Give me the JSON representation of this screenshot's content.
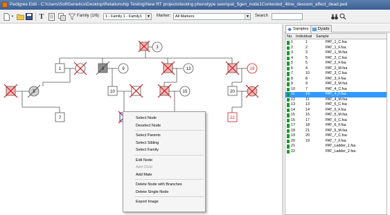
{
  "window": {
    "title": "Pedigree Edit - C:\\Users\\SoftGenetics\\Desktop\\Relationship Testing\\New RT projects\\testing phenotype seen\\pat_5gen_node1Contested_4line_descent_affect_dead.ped"
  },
  "toolbar": {
    "family_label": "Family (1/6):",
    "family_value": "1 - Family 1 - Family1",
    "marker_label": "Marker:",
    "marker_value": "All Markers",
    "search_label": "Search"
  },
  "colors": {
    "titlebar": "#3f6498",
    "selection": "#3399ff",
    "deceased_cross": "#cc1a1a",
    "node_stroke": "#555555",
    "sample_icon": "#1a9a2a",
    "highlight_node_fill": "#f6b8b8"
  },
  "pedigree": {
    "labels": {
      "n3": "3",
      "n1": "1",
      "n8": "8",
      "n9": "9",
      "n13": "13",
      "n19": "19",
      "n5": "5",
      "n10": "10",
      "n15": "15",
      "n20": "20",
      "n7": "7",
      "n22": "22",
      "n21": "21"
    }
  },
  "panel": {
    "tabs": [
      {
        "label": "Samples",
        "icon": "samples-icon"
      },
      {
        "label": "Dyads",
        "icon": "dyads-icon"
      }
    ],
    "columns": [
      "No.",
      "Individual",
      "Sample"
    ],
    "rows": [
      {
        "no": "1",
        "ind": "1",
        "sample": "PAT_1_C.fsa"
      },
      {
        "no": "2",
        "ind": "2",
        "sample": "PAT_1_F.fsa"
      },
      {
        "no": "3",
        "ind": "3",
        "sample": "PAT_1_M.fsa"
      },
      {
        "no": "4",
        "ind": "5",
        "sample": "PAT_2_C.fsa"
      },
      {
        "no": "5",
        "ind": "5",
        "sample": "PAT_2_F.fsa"
      },
      {
        "no": "6",
        "ind": "4",
        "sample": "PAT_2_M.fsa"
      },
      {
        "no": "7",
        "ind": "10",
        "sample": "PAT_3_C.fsa"
      },
      {
        "no": "8",
        "ind": "8",
        "sample": "PAT_3_F.fsa"
      },
      {
        "no": "9",
        "ind": "9",
        "sample": "PAT_3_M.fsa"
      },
      {
        "no": "10",
        "ind": "7",
        "sample": "PAT_4_C.fsa"
      },
      {
        "no": "11",
        "ind": "10",
        "sample": "PAT_4_F.fsa"
      },
      {
        "no": "12",
        "ind": "11",
        "sample": "PAT_4_M.fsa"
      },
      {
        "no": "13",
        "ind": "13",
        "sample": "PAT_5_C.fsa"
      },
      {
        "no": "14",
        "ind": "14",
        "sample": "PAT_5_F.fsa"
      },
      {
        "no": "15",
        "ind": "15",
        "sample": "PAT_5_M.fsa"
      },
      {
        "no": "16",
        "ind": "17",
        "sample": "PAT_6_C.fsa"
      },
      {
        "no": "17",
        "ind": "18",
        "sample": "PAT_6_F.fsa"
      },
      {
        "no": "18",
        "ind": "21",
        "sample": "PAT_6_M.fsa"
      },
      {
        "no": "19",
        "ind": "20",
        "sample": "PAT_7_C.fsa"
      },
      {
        "no": "20",
        "ind": "19",
        "sample": "PAT_7_F.fsa"
      },
      {
        "no": "21",
        "ind": "",
        "sample": "PAT_Ladder_1.fsa"
      },
      {
        "no": "22",
        "ind": "",
        "sample": "PAT_Ladder_2.fsa"
      }
    ],
    "selected_index": 10
  },
  "context_menu": {
    "items": [
      {
        "label": "Select Node",
        "enabled": true
      },
      {
        "label": "Deselect Node",
        "enabled": true
      },
      {
        "sep": true
      },
      {
        "label": "Select Parents",
        "enabled": true
      },
      {
        "label": "Select Sibling",
        "enabled": true
      },
      {
        "label": "Select Family",
        "enabled": true
      },
      {
        "sep": true
      },
      {
        "label": "Edit Node",
        "enabled": true
      },
      {
        "label": "Add Child",
        "enabled": false
      },
      {
        "label": "Add Mate",
        "enabled": true
      },
      {
        "sep": true
      },
      {
        "label": "Delete Node with Branches",
        "enabled": true
      },
      {
        "label": "Delete Single Node",
        "enabled": true
      },
      {
        "sep": true
      },
      {
        "label": "Export Image",
        "enabled": true
      }
    ]
  }
}
